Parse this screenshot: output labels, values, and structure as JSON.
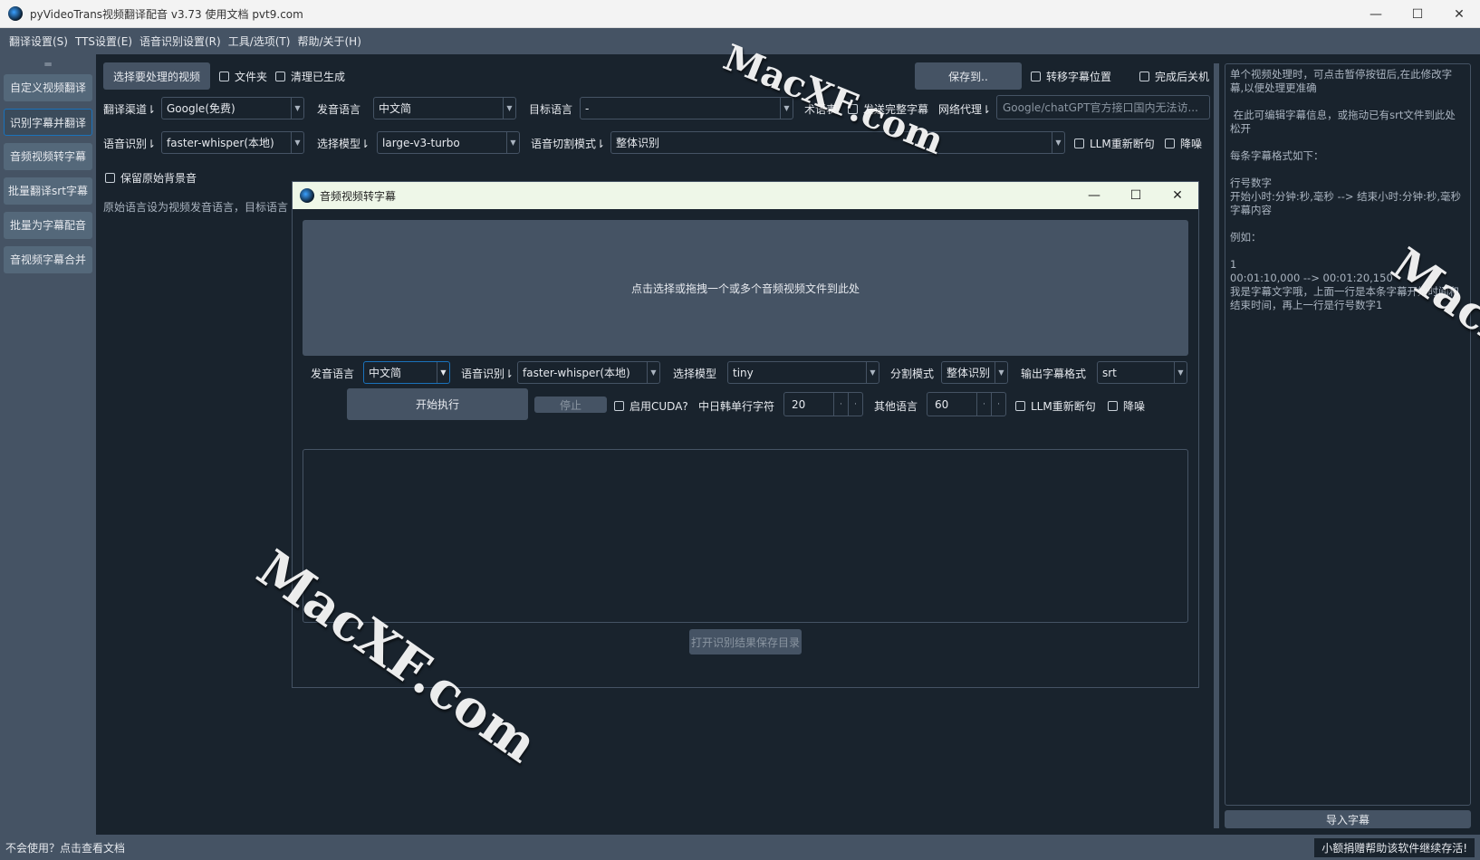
{
  "window": {
    "title": "pyVideoTrans视频翻译配音 v3.73  使用文档  pvt9.com",
    "minimize": "—",
    "maximize": "☐",
    "close": "✕"
  },
  "menu": [
    "翻译设置(S)",
    "TTS设置(E)",
    "语音识别设置(R)",
    "工具/选项(T)",
    "帮助/关于(H)"
  ],
  "leftnav": {
    "handle": "═",
    "items": [
      "自定义视频翻译",
      "识别字幕并翻译",
      "音频视频转字幕",
      "批量翻译srt字幕",
      "批量为字幕配音",
      "音视频字幕合并"
    ],
    "active_index": 1
  },
  "toolbar": {
    "select_video": "选择要处理的视频",
    "folder": "文件夹",
    "clear_generated": "清理已生成",
    "save_to": "保存到..",
    "move_subtitle_pos": "转移字幕位置",
    "shutdown_after": "完成后关机"
  },
  "row2": {
    "translate_channel_label": "翻译渠道⇂",
    "translate_channel_value": "Google(免费)",
    "source_lang_label": "发音语言",
    "source_lang_value": "中文简",
    "target_lang_label": "目标语言",
    "target_lang_value": "-",
    "glossary": "术语表",
    "send_full_subtitle": "发送完整字幕",
    "proxy_label": "网络代理⇂",
    "proxy_placeholder": "Google/chatGPT官方接口国内无法访..."
  },
  "row3": {
    "asr_label": "语音识别⇂",
    "asr_value": "faster-whisper(本地)",
    "model_label": "选择模型⇂",
    "model_value": "large-v3-turbo",
    "split_label": "语音切割模式⇂",
    "split_value": "整体识别",
    "llm_resplit": "LLM重新断句",
    "denoise": "降噪"
  },
  "row4": {
    "keep_bg": "保留原始背景音",
    "hint": "原始语言设为视频发音语言，目标语言"
  },
  "dialog": {
    "title": "音频视频转字幕",
    "dropzone": "点击选择或拖拽一个或多个音频视频文件到此处",
    "lang_label": "发音语言",
    "lang_value": "中文简",
    "asr_label": "语音识别⇂",
    "asr_value": "faster-whisper(本地)",
    "model_label": "选择模型",
    "model_value": "tiny",
    "split_label": "分割模式",
    "split_value": "整体识别",
    "format_label": "输出字幕格式",
    "format_value": "srt",
    "start": "开始执行",
    "stop": "停止",
    "cuda": "启用CUDA?",
    "cjk_chars_label": "中日韩单行字符",
    "cjk_chars_value": "20",
    "other_lang_label": "其他语言",
    "other_lang_value": "60",
    "llm_resplit": "LLM重新断句",
    "denoise": "降噪",
    "open_dir": "打开识别结果保存目录"
  },
  "notes": "单个视频处理时，可点击暂停按钮后,在此修改字幕,以便处理更准确\n\n 在此可编辑字幕信息，或拖动已有srt文件到此处松开\n\n每条字幕格式如下：\n\n行号数字\n开始小时:分钟:秒,毫秒 --> 结束小时:分钟:秒,毫秒\n字幕内容\n\n例如：\n\n1\n00:01:10,000 --> 00:01:20,150\n我是字幕文字哦，上面一行是本条字幕开始时间和结束时间，再上一行是行号数字1",
  "import_subtitle": "导入字幕",
  "status": {
    "help": "不会使用？点击查看文档",
    "donate": "小额捐赠帮助该软件继续存活!"
  },
  "watermarks": [
    "MacXF.com",
    "MacXF.com",
    "MacXF.com"
  ],
  "colors": {
    "background": "#19232d",
    "panel": "#455364",
    "accent": "#1a72bb"
  }
}
